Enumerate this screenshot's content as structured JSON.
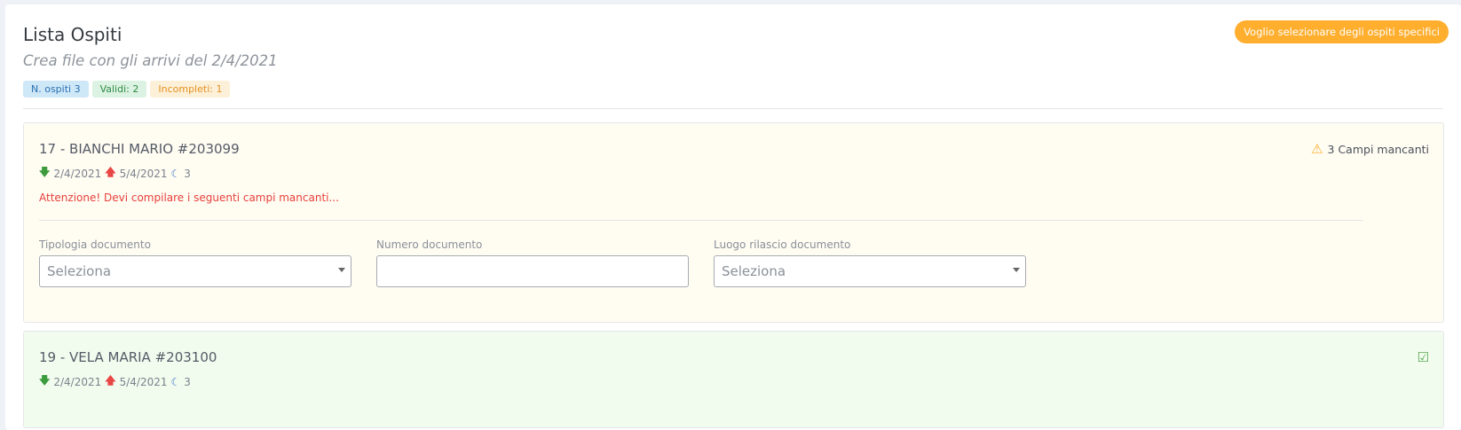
{
  "header": {
    "title": "Lista Ospiti",
    "subtitle": "Crea file con gli arrivi del 2/4/2021",
    "select_button": "Voglio selezionare degli ospiti specifici"
  },
  "badges": {
    "guests": "N. ospiti 3",
    "valid": "Validi: 2",
    "incomplete": "Incompleti: 1"
  },
  "colors": {
    "accent": "#ffae2e",
    "incomplete_bg": "#fffcf2",
    "valid_bg": "#f1fcef",
    "alert": "#e8403c"
  },
  "guests": [
    {
      "name": "17 - BIANCHI MARIO #203099",
      "arrival": "2/4/2021",
      "departure": "5/4/2021",
      "nights": "3",
      "status": "3 Campi mancanti",
      "alert": "Attenzione! Devi compilare i seguenti campi mancanti...",
      "fields": {
        "doc_type_label": "Tipologia documento",
        "doc_type_value": "Seleziona",
        "doc_number_label": "Numero documento",
        "doc_number_value": "",
        "doc_place_label": "Luogo rilascio documento",
        "doc_place_value": "Seleziona"
      }
    },
    {
      "name": "19 - VELA MARIA #203100",
      "arrival": "2/4/2021",
      "departure": "5/4/2021",
      "nights": "3"
    }
  ]
}
